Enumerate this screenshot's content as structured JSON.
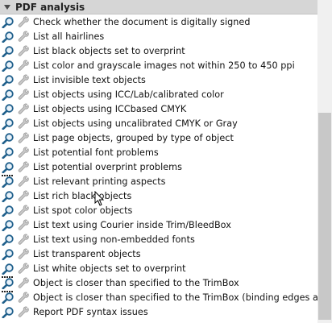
{
  "section": {
    "title": "PDF analysis"
  },
  "items": [
    {
      "label": "Check whether the document is digitally signed",
      "icon": "magnifier-icon"
    },
    {
      "label": "List all hairlines",
      "icon": "magnifier-icon"
    },
    {
      "label": "List black objects set to overprint",
      "icon": "magnifier-icon"
    },
    {
      "label": "List color and grayscale images not within 250 to 450 ppi",
      "icon": "magnifier-icon"
    },
    {
      "label": "List invisible text objects",
      "icon": "magnifier-icon"
    },
    {
      "label": "List objects using ICC/Lab/calibrated color",
      "icon": "magnifier-icon"
    },
    {
      "label": "List objects using ICCbased CMYK",
      "icon": "magnifier-icon"
    },
    {
      "label": "List objects using uncalibrated CMYK or Gray",
      "icon": "magnifier-icon"
    },
    {
      "label": "List page objects, grouped by type of object",
      "icon": "magnifier-icon"
    },
    {
      "label": "List potential font problems",
      "icon": "magnifier-icon"
    },
    {
      "label": "List potential overprint problems",
      "icon": "magnifier-icon"
    },
    {
      "label": "List relevant printing aspects",
      "icon": "magnifier-dotted-icon"
    },
    {
      "label": "List rich black objects",
      "icon": "magnifier-icon"
    },
    {
      "label": "List spot color objects",
      "icon": "magnifier-icon"
    },
    {
      "label": "List text using Courier inside Trim/BleedBox",
      "icon": "magnifier-icon"
    },
    {
      "label": "List text using non-embedded fonts",
      "icon": "magnifier-icon"
    },
    {
      "label": "List transparent objects",
      "icon": "magnifier-icon"
    },
    {
      "label": "List white objects set to overprint",
      "icon": "magnifier-icon"
    },
    {
      "label": "Object is closer than specified to the TrimBox",
      "icon": "magnifier-dotted-icon"
    },
    {
      "label": "Object is closer than specified to the TrimBox (binding edges are n",
      "icon": "magnifier-dotted-icon"
    },
    {
      "label": "Report PDF syntax issues",
      "icon": "magnifier-icon"
    }
  ],
  "colors": {
    "header_bg": "#d6d6d6",
    "magnifier": "#1f5f8b",
    "wrench": "#b7b7b7"
  }
}
